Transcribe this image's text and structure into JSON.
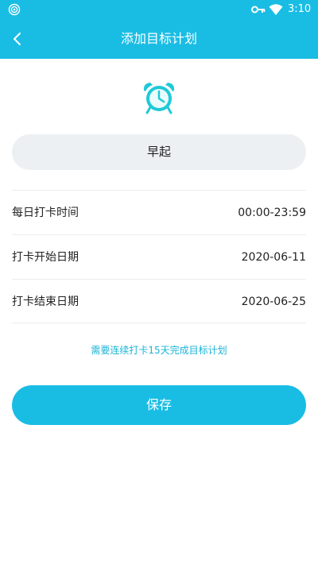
{
  "status_bar": {
    "time": "3:10",
    "icons": [
      "podcast-icon",
      "key-icon",
      "wifi-icon"
    ]
  },
  "nav": {
    "title": "添加目标计划",
    "back_icon": "chevron-left-icon"
  },
  "goal": {
    "icon": "alarm-clock-icon",
    "icon_color": "#1fc9d8",
    "name": "早起"
  },
  "rows": [
    {
      "label": "每日打卡时间",
      "value": "00:00-23:59"
    },
    {
      "label": "打卡开始日期",
      "value": "2020-06-11"
    },
    {
      "label": "打卡结束日期",
      "value": "2020-06-25"
    }
  ],
  "hint": "需要连续打卡15天完成目标计划",
  "save_label": "保存",
  "colors": {
    "accent": "#19bde4",
    "hint": "#19b3d8",
    "input_bg": "#edf0f2"
  }
}
